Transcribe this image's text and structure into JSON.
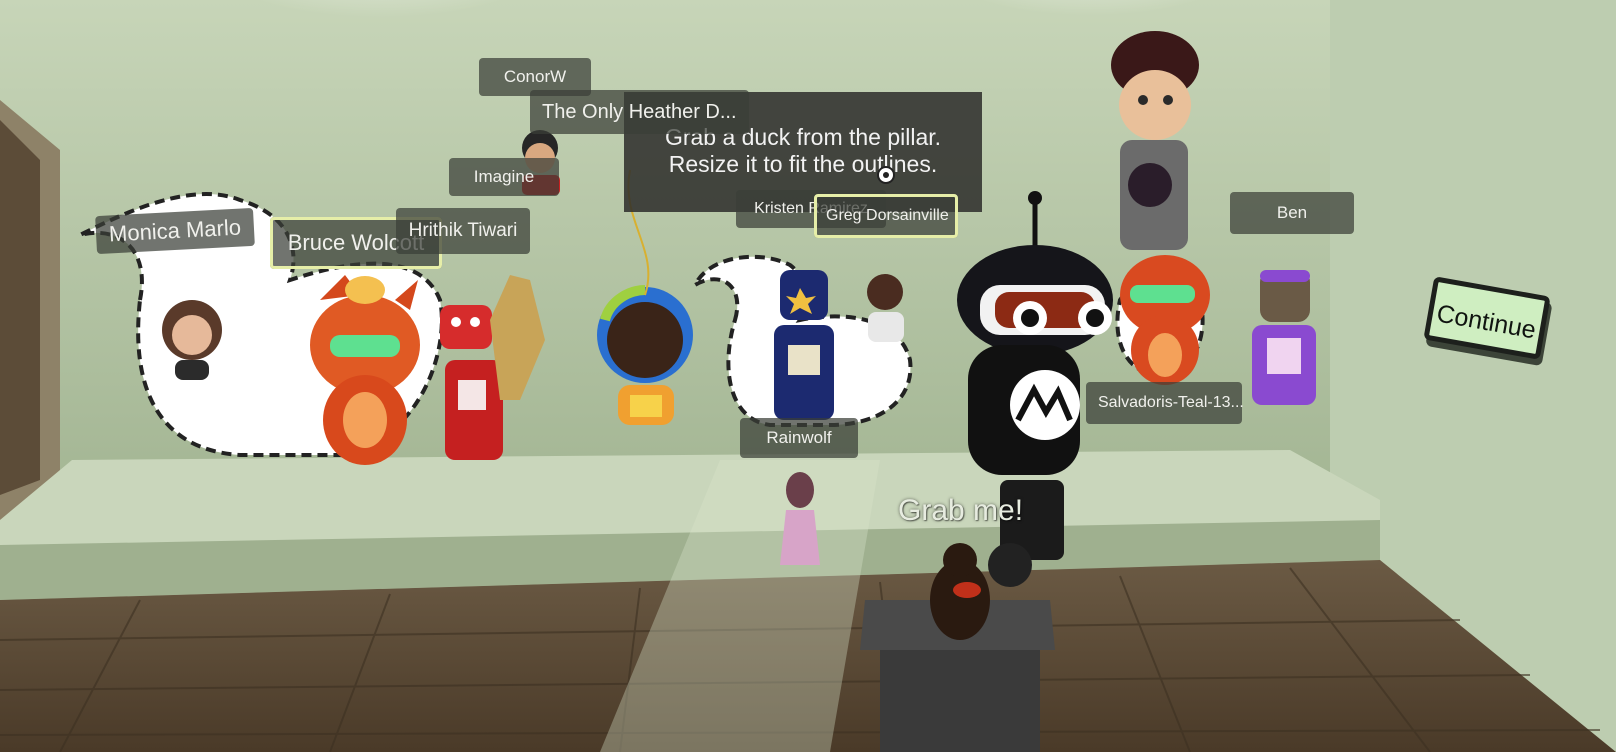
{
  "scene": {
    "instruction": {
      "line1": "Grab a duck from the pillar.",
      "line2": "Resize it to fit the outlines."
    },
    "grab_prompt": "Grab me!",
    "continue_label": "Continue",
    "cursor_icon": "reticle-icon"
  },
  "players": [
    {
      "name": "ConorW"
    },
    {
      "name": "The Only Heather D..."
    },
    {
      "name": "Imagine"
    },
    {
      "name": "Monica Marlo"
    },
    {
      "name": "Bruce Wolcott",
      "selected": true
    },
    {
      "name": "Hrithik Tiwari"
    },
    {
      "name": "Kristen Ramirez"
    },
    {
      "name": "Greg Dorsainville",
      "selected": true
    },
    {
      "name": "Ben"
    },
    {
      "name": "Rainwolf"
    },
    {
      "name": "Salvadoris-Teal-13..."
    }
  ],
  "colors": {
    "wall": "#aebf9f",
    "floor": "#6e5a40",
    "outline_highlight": "#e6eea8",
    "continue_button": "#cfeec1"
  }
}
